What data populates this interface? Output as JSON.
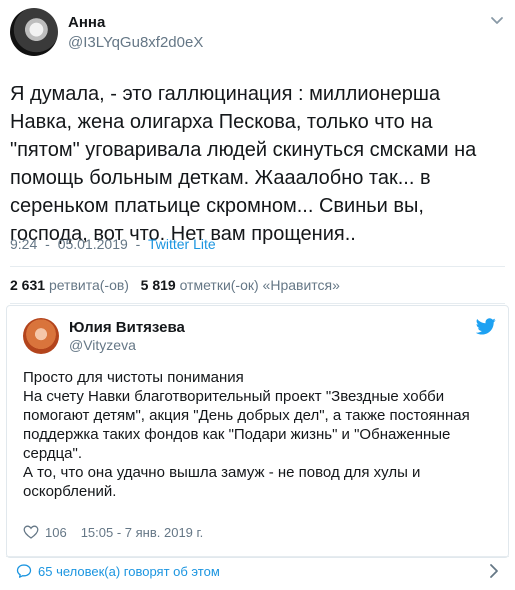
{
  "main_tweet": {
    "author_name": "Анна",
    "handle": "@I3LYqGu8xf2d0eX",
    "text": "Я думала, - это галлюцинация : миллионерша Навка, жена олигарха Пескова, только что на \"пятом\" уговаривала людей скинуться смсками на помощь больным деткам. Жааалобно так... в сереньком платьице скромном... Свиньи вы, господа,  вот что. Нет вам прощения..",
    "time": "9:24",
    "date": "05.01.2019",
    "client": "Twitter Lite",
    "separator": "-",
    "retweets_count": "2 631",
    "retweets_label": "ретвита(-ов)",
    "likes_count": "5 819",
    "likes_label": "отметки(-ок) «Нравится»"
  },
  "quoted_tweet": {
    "author_name": "Юлия Витязева",
    "handle": "@Vityzeva",
    "text": "Просто для чистоты понимания\nНа счету Навки благотворительный проект \"Звездные хобби помогают детям\", акция \"День добрых дел\", а также постоянная поддержка таких фондов как \"Подари жизнь\" и \"Обнаженные сердца\".\nА то, что она удачно вышла замуж - не повод для хулы и оскорблений.",
    "likes": "106",
    "timestamp": "15:05 - 7 янв. 2019 г."
  },
  "footer": {
    "talking_text": "65 человек(а) говорят об этом"
  },
  "icons": {
    "caret": "chevron-down-icon",
    "bird": "twitter-bird-icon",
    "heart": "heart-icon",
    "bubble": "speech-bubble-icon",
    "chevron": "chevron-right-icon"
  },
  "colors": {
    "accent": "#1b95e0",
    "text": "#14171a",
    "muted": "#657786",
    "border": "#e1e8ed"
  }
}
